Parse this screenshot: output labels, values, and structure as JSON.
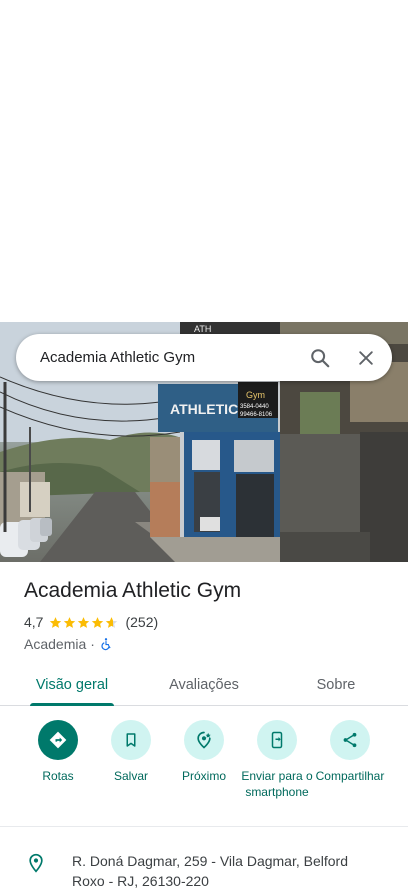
{
  "search": {
    "query": "Academia Athletic Gym"
  },
  "place": {
    "name": "Academia Athletic Gym",
    "rating": "4,7",
    "stars": 4.7,
    "review_count": "(252)",
    "category": "Academia",
    "separator": "·"
  },
  "photo": {
    "sign_text": "ATHLETIC",
    "sign_text2": "Gym",
    "phone1": "3584-0440",
    "phone2": "99466-8106"
  },
  "tabs": [
    {
      "label": "Visão geral",
      "active": true
    },
    {
      "label": "Avaliações",
      "active": false
    },
    {
      "label": "Sobre",
      "active": false
    }
  ],
  "actions": [
    {
      "label": "Rotas",
      "icon": "directions-icon"
    },
    {
      "label": "Salvar",
      "icon": "bookmark-icon"
    },
    {
      "label": "Próximo",
      "icon": "nearby-icon"
    },
    {
      "label": "Enviar para o smartphone",
      "icon": "send-to-phone-icon"
    },
    {
      "label": "Compartilhar",
      "icon": "share-icon"
    }
  ],
  "address": {
    "line": "R. Doná Dagmar, 259 - Vila Dagmar, Belford Roxo - RJ, 26130-220"
  },
  "colors": {
    "accent": "#00796b",
    "action_bg": "#d0f4f1",
    "star": "#fbbc04"
  }
}
